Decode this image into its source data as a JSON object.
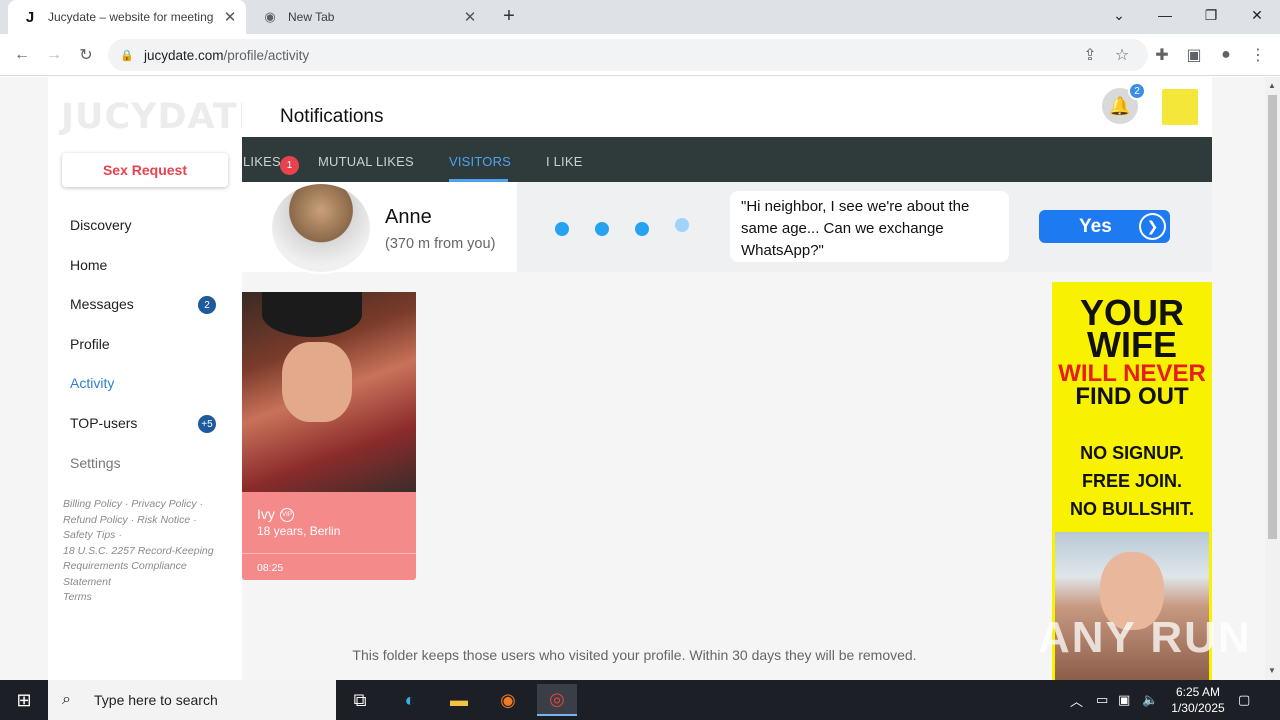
{
  "browser": {
    "tabs": [
      {
        "title": "Jucydate – website for meeting",
        "active": true,
        "favicon": "J"
      },
      {
        "title": "New Tab",
        "active": false,
        "favicon": "chrome-icon"
      }
    ],
    "new_tab_label": "+",
    "url_domain": "jucydate.com",
    "url_path": "/profile/activity"
  },
  "sidebar": {
    "logo": "JUCYDATE",
    "cta": "Sex Request",
    "items": [
      {
        "label": "Discovery"
      },
      {
        "label": "Home"
      },
      {
        "label": "Messages",
        "badge": "2"
      },
      {
        "label": "Profile"
      },
      {
        "label": "Activity",
        "active": true
      },
      {
        "label": "TOP-users",
        "badge": "+5"
      },
      {
        "label": "Settings"
      }
    ],
    "footer_links": [
      "Billing Policy ·",
      "Privacy Policy ·",
      "Refund Policy ·",
      "Risk Notice ·",
      "Safety Tips ·",
      "18 U.S.C. 2257 Record-Keeping Requirements Compliance Statement",
      "Terms"
    ]
  },
  "header": {
    "title": "Notifications",
    "notification_count": "2"
  },
  "tabs": [
    {
      "label": "LIKES",
      "badge": "1"
    },
    {
      "label": "MUTUAL LIKES"
    },
    {
      "label": "VISITORS",
      "active": true
    },
    {
      "label": "I LIKE"
    }
  ],
  "promo": {
    "name": "Anne",
    "distance": "(370 m from you)",
    "message": "\"Hi neighbor, I see we're about the same age... Can we exchange WhatsApp?\"",
    "button": "Yes"
  },
  "visitors": [
    {
      "name": "Ivy",
      "info": "18 years, Berlin",
      "time": "08:25"
    }
  ],
  "folder_note": "This folder keeps those users who visited your profile. Within 30 days they will be removed.",
  "ad": {
    "line1": "YOUR",
    "line2": "WIFE",
    "line3": "WILL NEVER",
    "line4": "FIND OUT",
    "line5": "NO SIGNUP.",
    "line6": "FREE JOIN.",
    "line7": "NO BULLSHIT."
  },
  "watermark": "ANY RUN",
  "taskbar": {
    "search_placeholder": "Type here to search",
    "time": "6:25 AM",
    "date": "1/30/2025"
  },
  "colors": {
    "accent": "#4ea3f0",
    "brand_red": "#e8424f",
    "tabbar": "#2f3b3a",
    "ad_yellow": "#f8f200"
  }
}
